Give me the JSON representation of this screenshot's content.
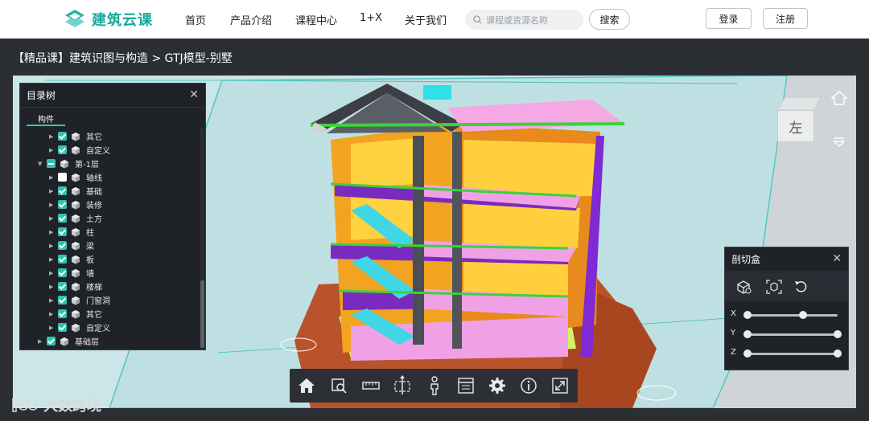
{
  "brand": {
    "name": "建筑云课",
    "color": "#1aa89a"
  },
  "nav": {
    "items": [
      "首页",
      "产品介绍",
      "课程中心",
      "1+X",
      "关于我们"
    ],
    "search_placeholder": "课程或资源名称",
    "search_button": "搜索",
    "login": "登录",
    "register": "注册"
  },
  "breadcrumb": "【精品课】建筑识图与构造 > GTJ模型-别墅",
  "tree": {
    "title": "目录树",
    "tab": "构件",
    "rows": [
      {
        "label": "其它",
        "state": "checked",
        "level": 2
      },
      {
        "label": "自定义",
        "state": "checked",
        "level": 2
      },
      {
        "label": "第-1层",
        "state": "partial",
        "level": 1,
        "expanded": true
      },
      {
        "label": "轴线",
        "state": "unchecked",
        "level": 2
      },
      {
        "label": "基础",
        "state": "checked",
        "level": 2
      },
      {
        "label": "装修",
        "state": "checked",
        "level": 2
      },
      {
        "label": "土方",
        "state": "checked",
        "level": 2
      },
      {
        "label": "柱",
        "state": "checked",
        "level": 2
      },
      {
        "label": "梁",
        "state": "checked",
        "level": 2
      },
      {
        "label": "板",
        "state": "checked",
        "level": 2
      },
      {
        "label": "墙",
        "state": "checked",
        "level": 2
      },
      {
        "label": "楼梯",
        "state": "checked",
        "level": 2
      },
      {
        "label": "门窗洞",
        "state": "checked",
        "level": 2
      },
      {
        "label": "其它",
        "state": "checked",
        "level": 2
      },
      {
        "label": "自定义",
        "state": "checked",
        "level": 2
      },
      {
        "label": "基础层",
        "state": "checked",
        "level": 1
      }
    ]
  },
  "section_box": {
    "title": "剖切盒",
    "axes": [
      {
        "label": "X",
        "min_pos": 0.0,
        "max_pos": 0.62
      },
      {
        "label": "Y",
        "min_pos": 0.0,
        "max_pos": 1.0
      },
      {
        "label": "Z",
        "min_pos": 0.0,
        "max_pos": 1.0
      }
    ],
    "icons": [
      "hide-box-icon",
      "fit-box-icon",
      "reset-icon"
    ]
  },
  "toolbar": {
    "icons": [
      "home-icon",
      "zoom-window-icon",
      "measure-ruler-icon",
      "section-plane-icon",
      "person-walk-icon",
      "properties-icon",
      "settings-icon",
      "info-icon",
      "fullscreen-icon"
    ]
  },
  "view_cube": {
    "face": "左"
  },
  "watermark": "大数跨境",
  "colors": {
    "accent": "#2ec4b0",
    "panel": "#1f2227",
    "viewer_bg": "#cfd4d8"
  }
}
